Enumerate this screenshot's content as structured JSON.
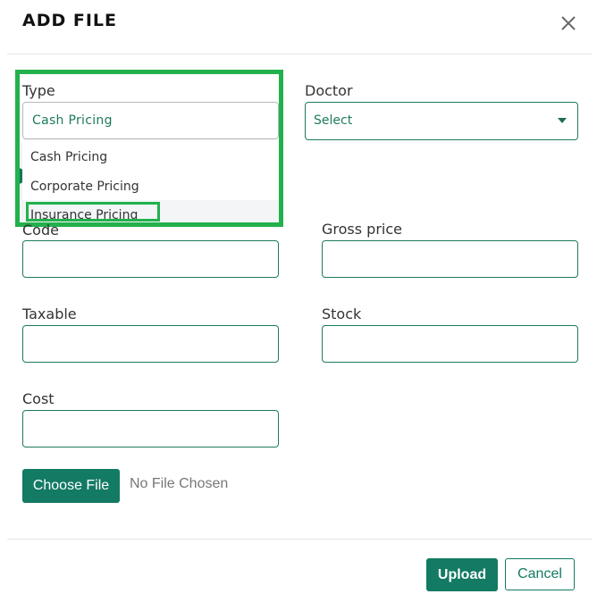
{
  "dialog": {
    "title": "ADD FILE",
    "close_icon": "close-icon"
  },
  "form": {
    "type": {
      "label": "Type",
      "value": "Cash Pricing",
      "options": [
        "Cash Pricing",
        "Corporate Pricing",
        "Insurance Pricing"
      ],
      "highlighted_option": "Insurance Pricing"
    },
    "doctor": {
      "label": "Doctor",
      "value": "Select",
      "icon": "chevron-down-icon"
    },
    "code": {
      "label": "Code",
      "value": ""
    },
    "gross_price": {
      "label": "Gross price",
      "value": ""
    },
    "taxable": {
      "label": "Taxable",
      "value": ""
    },
    "stock": {
      "label": "Stock",
      "value": ""
    },
    "cost": {
      "label": "Cost",
      "value": ""
    },
    "file": {
      "button_label": "Choose File",
      "status": "No File Chosen"
    }
  },
  "footer": {
    "upload_label": "Upload",
    "cancel_label": "Cancel"
  },
  "colors": {
    "primary": "#137a63",
    "highlight_frame": "#22b14c",
    "border": "#1e7a5f"
  }
}
